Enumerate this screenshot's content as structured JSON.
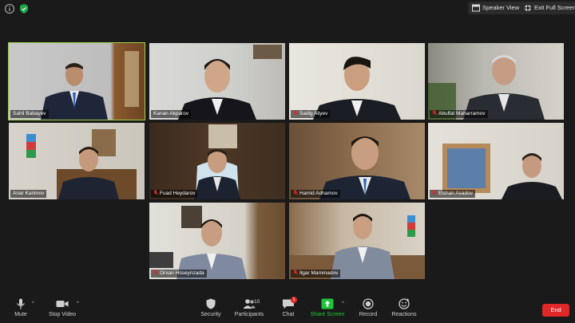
{
  "top": {
    "speaker_view_label": "Speaker View",
    "exit_full_screen_label": "Exit Full Screen"
  },
  "participants": [
    {
      "name": "Sahil Babayev",
      "muted": false,
      "active": true
    },
    {
      "name": "Kanan Akparov",
      "muted": true,
      "active": false
    },
    {
      "name": "Sadig Aliyev",
      "muted": true,
      "active": false
    },
    {
      "name": "Abulfat Maharramov",
      "muted": true,
      "active": false
    },
    {
      "name": "Anar Karimov",
      "muted": false,
      "active": false
    },
    {
      "name": "Fuad Heydarov",
      "muted": true,
      "active": false
    },
    {
      "name": "Hamid Adhamov",
      "muted": true,
      "active": false
    },
    {
      "name": "Elshan Asadov",
      "muted": true,
      "active": false
    },
    {
      "name": "Orxan Hüseynzada",
      "muted": true,
      "active": false
    },
    {
      "name": "Ilgar Mammadov",
      "muted": true,
      "active": false
    }
  ],
  "toolbar": {
    "mute_label": "Mute",
    "stop_video_label": "Stop Video",
    "security_label": "Security",
    "participants_label": "Participants",
    "participants_count": "10",
    "chat_label": "Chat",
    "chat_badge": "1",
    "share_screen_label": "Share Screen",
    "record_label": "Record",
    "reactions_label": "Reactions",
    "end_label": "End"
  },
  "colors": {
    "active_speaker_border": "#9fd24b",
    "share_screen_green": "#20c43a",
    "end_red": "#e02828",
    "muted_mic_red": "#e02828"
  }
}
